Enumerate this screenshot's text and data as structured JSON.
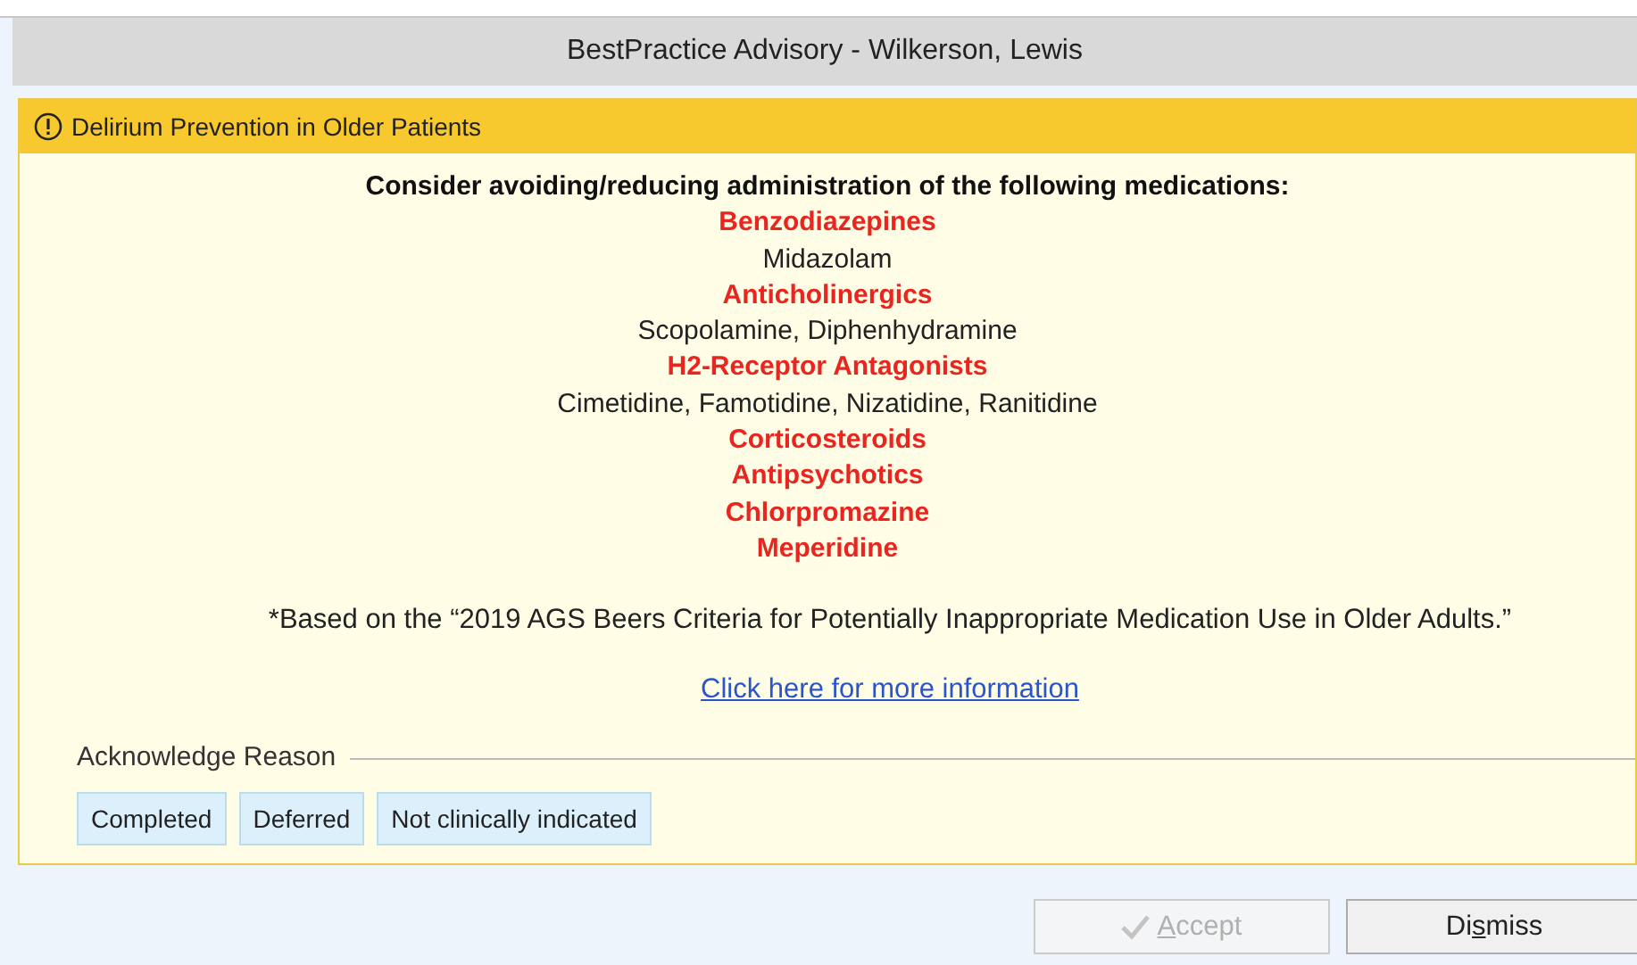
{
  "window": {
    "title": "BestPractice Advisory - Wilkerson, Lewis"
  },
  "advisory": {
    "title": "Delirium Prevention in Older Patients",
    "heading": "Consider avoiding/reducing administration of the following medications:",
    "lines": [
      {
        "kind": "class",
        "text": "Benzodiazepines"
      },
      {
        "kind": "drug",
        "text": "Midazolam"
      },
      {
        "kind": "class",
        "text": "Anticholinergics"
      },
      {
        "kind": "drug",
        "text": "Scopolamine, Diphenhydramine"
      },
      {
        "kind": "class",
        "text": "H2-Receptor Antagonists"
      },
      {
        "kind": "drug",
        "text": "Cimetidine, Famotidine, Nizatidine, Ranitidine"
      },
      {
        "kind": "class",
        "text": "Corticosteroids"
      },
      {
        "kind": "class",
        "text": "Antipsychotics"
      },
      {
        "kind": "class",
        "text": "Chlorpromazine"
      },
      {
        "kind": "class",
        "text": "Meperidine"
      }
    ],
    "footnote": "*Based on the “2019 AGS Beers Criteria for Potentially Inappropriate Medication Use in Older Adults.”",
    "link": "Click here for more information",
    "acknowledge": {
      "label": "Acknowledge Reason",
      "options": [
        {
          "label": "Completed",
          "selected": false
        },
        {
          "label": "Deferred",
          "selected": false
        },
        {
          "label": "Not clinically indicated",
          "selected": false
        }
      ]
    }
  },
  "buttons": [
    {
      "kind": "accept",
      "disabled": true,
      "parts": [
        {
          "text": "A",
          "mnemonic": true
        },
        {
          "text": "ccept",
          "mnemonic": false
        }
      ]
    },
    {
      "kind": "dismiss",
      "disabled": false,
      "parts": [
        {
          "text": "Di",
          "mnemonic": false
        },
        {
          "text": "s",
          "mnemonic": true
        },
        {
          "text": "miss",
          "mnemonic": false
        }
      ]
    }
  ]
}
